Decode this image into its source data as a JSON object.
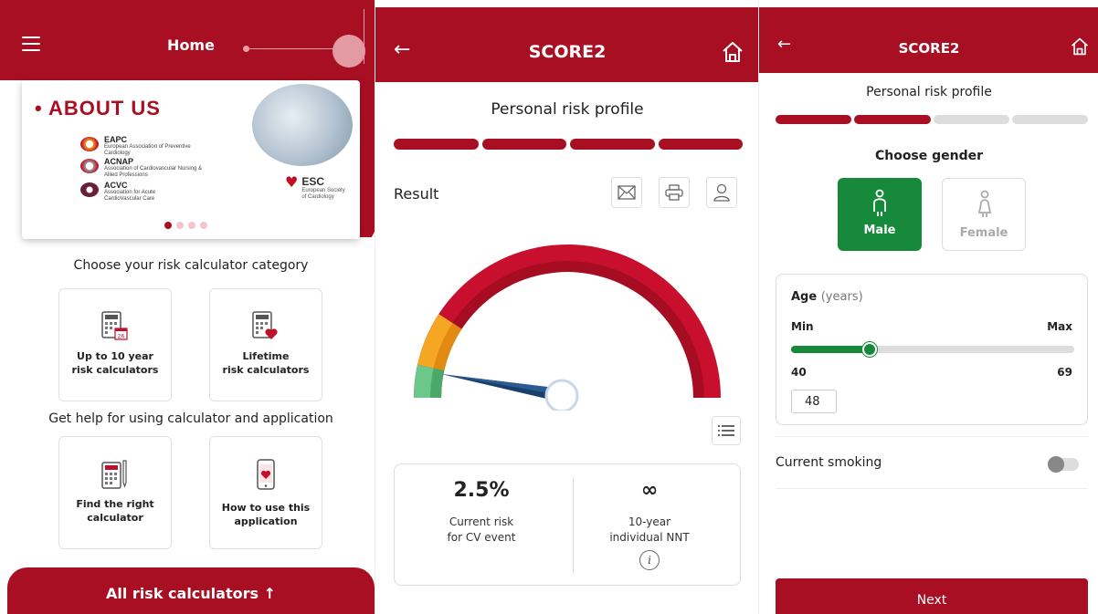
{
  "home": {
    "title": "Home",
    "about": {
      "title": "• ABOUT US",
      "orgs": [
        {
          "name": "EAPC",
          "sub": "European Association of Preventive Cardiology"
        },
        {
          "name": "ACNAP",
          "sub": "Association of Cardiovascular Nursing & Allied Professions"
        },
        {
          "name": "ACVC",
          "sub": "Association for Acute CardioVascular Care"
        }
      ],
      "esc": {
        "name": "ESC",
        "sub": "European Society of Cardiology"
      }
    },
    "category_label": "Choose your risk calculator category",
    "help_label": "Get help for using calculator and application",
    "cards": [
      {
        "line1": "Up to 10 year",
        "line2": "risk calculators",
        "icon": "calculator-calendar-icon"
      },
      {
        "line1": "Lifetime",
        "line2": "risk calculators",
        "icon": "calculator-heart-icon"
      },
      {
        "line1": "Find the right",
        "line2": "calculator",
        "icon": "calculator-pen-icon"
      },
      {
        "line1": "How to use this",
        "line2": "application",
        "icon": "phone-heart-icon"
      }
    ],
    "all_calculators": "All risk calculators ↑"
  },
  "result": {
    "title": "SCORE2",
    "subtitle": "Personal risk profile",
    "result_label": "Result",
    "current_risk_value": "2.5%",
    "current_risk_line1": "Current risk",
    "current_risk_line2": "for CV event",
    "nnt_value": "∞",
    "nnt_line1": "10-year",
    "nnt_line2": "individual NNT",
    "info": "i",
    "progress_steps_done": 4,
    "progress_steps_total": 4
  },
  "profile": {
    "title": "SCORE2",
    "subtitle": "Personal risk profile",
    "progress_steps_done": 2,
    "progress_steps_total": 4,
    "gender_title": "Choose gender",
    "male": "Male",
    "female": "Female",
    "age_title": "Age",
    "age_unit": "(years)",
    "min_label": "Min",
    "max_label": "Max",
    "min_value": "40",
    "max_value": "69",
    "age_value": "48",
    "smoking_label": "Current smoking",
    "next": "Next"
  },
  "colors": {
    "brand_red": "#a90f22",
    "green": "#168a3a"
  }
}
